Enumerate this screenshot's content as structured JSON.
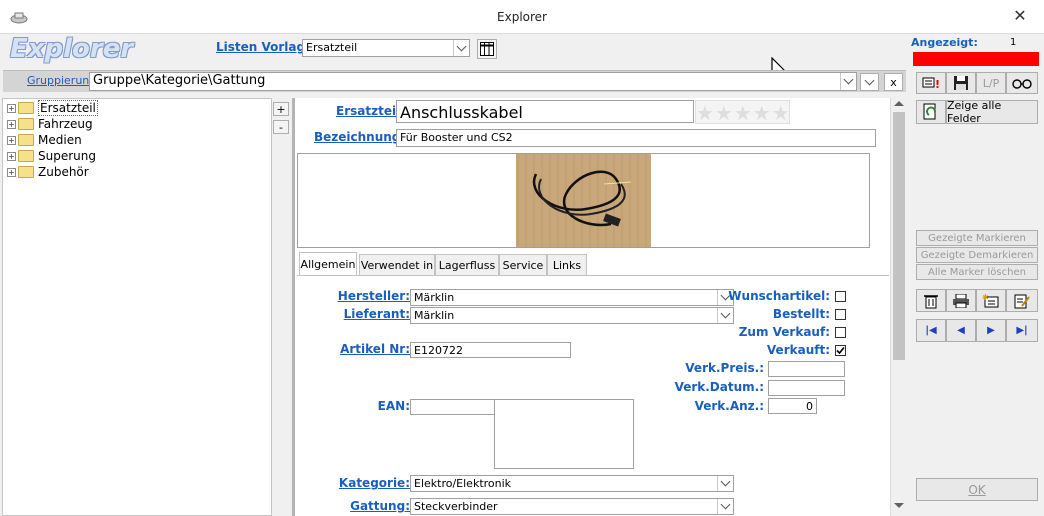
{
  "window": {
    "title": "Explorer",
    "brand": "Explorer",
    "close": "✕"
  },
  "toolbar": {
    "listen_vorlage_label": "Listen Vorlage:",
    "listen_vorlage_value": "Ersatzteil"
  },
  "grouping": {
    "label": "Gruppierung:",
    "value": "Gruppe\\Kategorie\\Gattung",
    "close": "x"
  },
  "tree": {
    "items": [
      "Ersatzteil",
      "Fahrzeug",
      "Medien",
      "Superung",
      "Zubehör"
    ],
    "expand_icon": "+",
    "collapse_icon": "-"
  },
  "record": {
    "ersatzteil_label": "Ersatzteil:",
    "ersatzteil_value": "Anschlusskabel",
    "bezeichnung_label": "Bezeichnung:",
    "bezeichnung_value": "Für Booster und CS2",
    "rating_stars": "★★★★★"
  },
  "tabs": [
    "Allgemein",
    "Verwendet in",
    "Lagerfluss",
    "Service",
    "Links"
  ],
  "form": {
    "hersteller_label": "Hersteller:",
    "hersteller_value": "Märklin",
    "lieferant_label": "Lieferant:",
    "lieferant_value": "Märklin",
    "artikel_nr_label": "Artikel Nr:",
    "artikel_nr_value": "E120722",
    "ean_label": "EAN:",
    "ean_value": "",
    "kategorie_label": "Kategorie:",
    "kategorie_value": "Elektro/Elektronik",
    "gattung_label": "Gattung:",
    "gattung_value": "Steckverbinder",
    "wunschartikel_label": "Wunschartikel:",
    "wunschartikel_checked": false,
    "bestellt_label": "Bestellt:",
    "bestellt_checked": false,
    "zum_verkauf_label": "Zum Verkauf:",
    "zum_verkauf_checked": false,
    "verkauft_label": "Verkauft:",
    "verkauft_checked": true,
    "verk_preis_label": "Verk.Preis.:",
    "verk_preis_value": "",
    "verk_datum_label": "Verk.Datum.:",
    "verk_datum_value": "",
    "verk_anz_label": "Verk.Anz.:",
    "verk_anz_value": "0"
  },
  "sidebar": {
    "angezeigt_label": "Angezeigt:",
    "angezeigt_value": "1",
    "lp_label": "L/P",
    "zeige_alle_felder": "Zeige alle Felder",
    "gezeigte_markieren": "Gezeigte Markieren",
    "gezeigte_demarkieren": "Gezeigte Demarkieren",
    "alle_marker_loeschen": "Alle Marker löschen",
    "nav_first": "|◀",
    "nav_prev": "◀",
    "nav_next": "▶",
    "nav_last": "▶|",
    "ok_label": "OK"
  },
  "colors": {
    "accent": "#1a5fbf",
    "alert": "#ff0000"
  }
}
